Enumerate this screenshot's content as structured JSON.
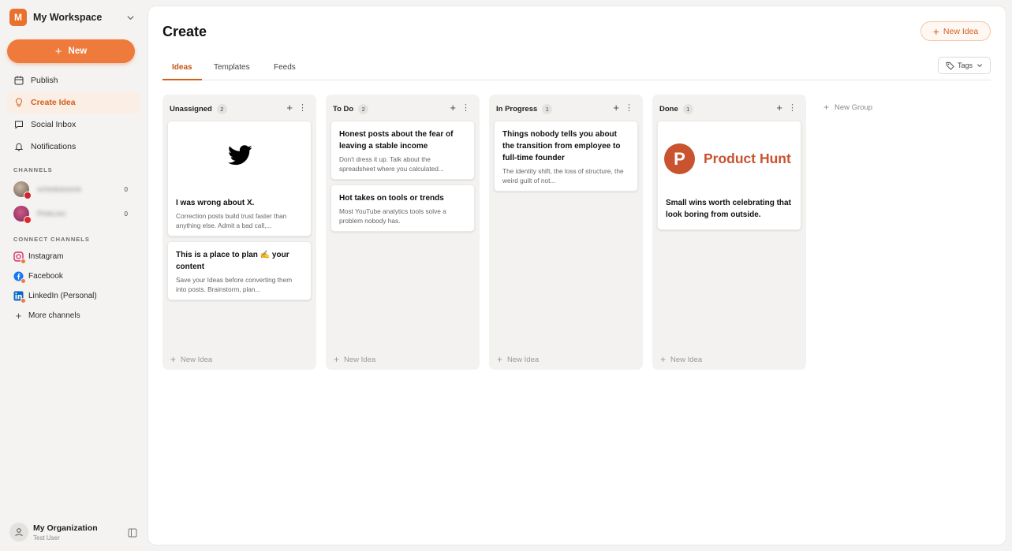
{
  "workspace": {
    "initial": "M",
    "name": "My Workspace"
  },
  "sidebar": {
    "new_label": "New",
    "nav": [
      {
        "label": "Publish",
        "icon": "calendar-icon"
      },
      {
        "label": "Create Idea",
        "icon": "lightbulb-icon",
        "active": true
      },
      {
        "label": "Social Inbox",
        "icon": "chat-icon"
      },
      {
        "label": "Notifications",
        "icon": "bell-icon"
      }
    ],
    "channels_label": "CHANNELS",
    "channels": [
      {
        "name": "schedulusme",
        "count": "0",
        "network": "pinterest"
      },
      {
        "name": "PinkLion",
        "count": "0",
        "network": "youtube"
      }
    ],
    "connect_label": "CONNECT CHANNELS",
    "connect": [
      {
        "label": "Instagram",
        "icon": "instagram-icon"
      },
      {
        "label": "Facebook",
        "icon": "facebook-icon"
      },
      {
        "label": "LinkedIn (Personal)",
        "icon": "linkedin-icon"
      },
      {
        "label": "More channels",
        "icon": "plus-icon"
      }
    ],
    "org": {
      "name": "My Organization",
      "user": "Test User"
    }
  },
  "header": {
    "title": "Create",
    "new_idea_label": "New Idea",
    "tabs": [
      "Ideas",
      "Templates",
      "Feeds"
    ],
    "tags_label": "Tags"
  },
  "board": {
    "new_idea_label": "New Idea",
    "new_group_label": "New Group",
    "columns": [
      {
        "title": "Unassigned",
        "count": "2",
        "cards": [
          {
            "title": "I was wrong about X.",
            "desc": "Correction posts build trust faster than anything else. Admit a bad call,..."
          },
          {
            "title": "This is a place to plan ✍️ your content",
            "desc": "Save your Ideas before converting them into posts. Brainstorm, plan..."
          }
        ]
      },
      {
        "title": "To Do",
        "count": "2",
        "cards": [
          {
            "title": "Honest posts about the fear of leaving a stable income",
            "desc": "Don't dress it up. Talk about the spreadsheet where you calculated..."
          },
          {
            "title": "Hot takes on tools or trends",
            "desc": "Most YouTube analytics tools solve a problem nobody has."
          }
        ]
      },
      {
        "title": "In Progress",
        "count": "1",
        "cards": [
          {
            "title": "Things nobody tells you about the transition from employee to full-time founder",
            "desc": "The identity shift, the loss of structure, the weird guilt of not..."
          }
        ]
      },
      {
        "title": "Done",
        "count": "1",
        "cards": [
          {
            "title": "Small wins worth celebrating that look boring from outside.",
            "brand": "Product Hunt",
            "brand_letter": "P"
          }
        ]
      }
    ]
  },
  "colors": {
    "accent": "#ee7a3c",
    "accent_dark": "#d35f1f",
    "product_hunt": "#c9532f",
    "twitter": "#000000"
  }
}
